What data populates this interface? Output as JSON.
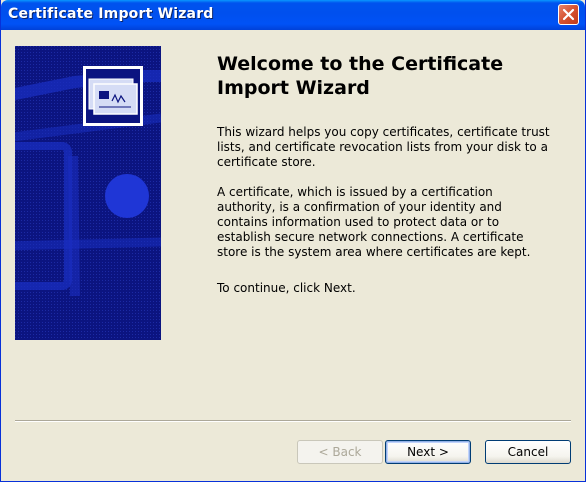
{
  "window": {
    "title": "Certificate Import Wizard"
  },
  "titlebar": {
    "close_icon": "close-icon"
  },
  "side_panel": {
    "icon": "certificate-icon"
  },
  "content": {
    "heading": "Welcome to the Certificate Import Wizard",
    "para1": "This wizard helps you copy certificates, certificate trust lists, and certificate revocation lists from your disk to a certificate store.",
    "para2": "A certificate, which is issued by a certification authority, is a confirmation of your identity and contains information used to protect data or to establish secure network connections. A certificate store is the system area where certificates are kept.",
    "para3": "To continue, click Next."
  },
  "buttons": {
    "back": "< Back",
    "next": "Next >",
    "cancel": "Cancel"
  },
  "colors": {
    "titlebar": "#0053ee",
    "panel": "#0b1480",
    "window_bg": "#ece9d8"
  }
}
